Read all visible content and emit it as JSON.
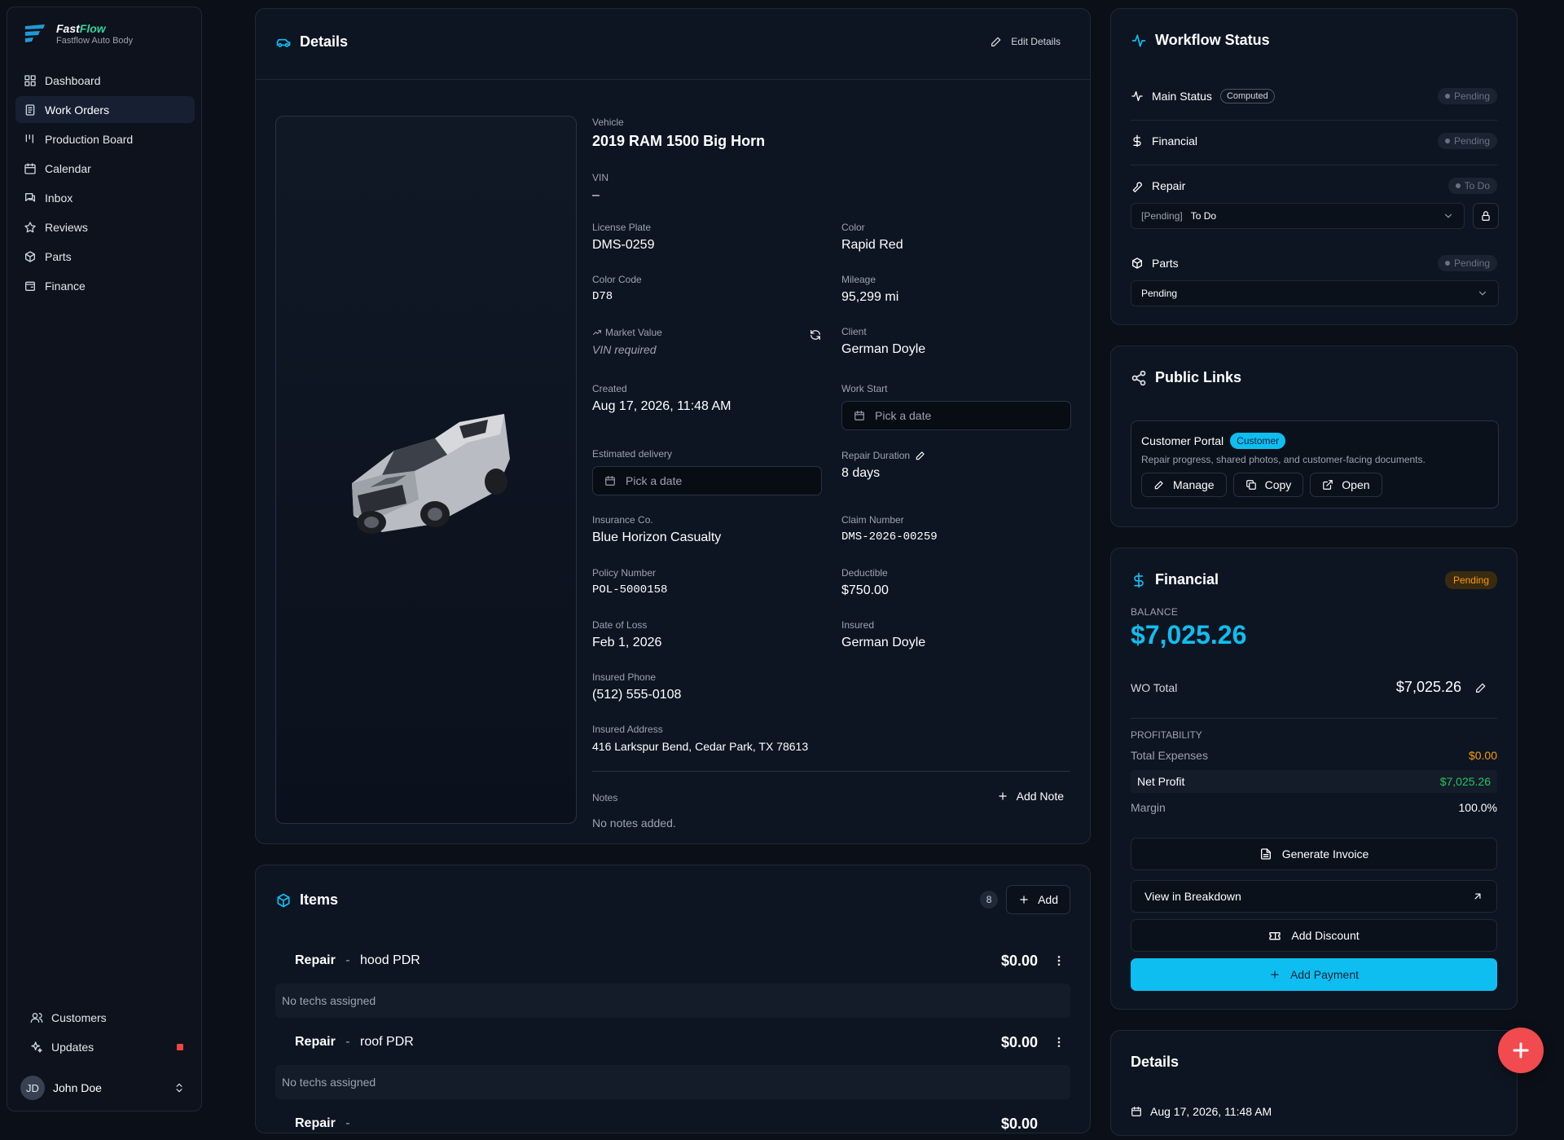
{
  "brand": {
    "name_a": "Fast",
    "name_b": "Flow",
    "subtitle": "Fastflow Auto Body"
  },
  "nav": {
    "items": [
      {
        "label": "Dashboard",
        "icon": "dashboard-icon"
      },
      {
        "label": "Work Orders",
        "icon": "clipboard-icon",
        "active": true
      },
      {
        "label": "Production Board",
        "icon": "board-icon"
      },
      {
        "label": "Calendar",
        "icon": "calendar-icon"
      },
      {
        "label": "Inbox",
        "icon": "inbox-icon"
      },
      {
        "label": "Reviews",
        "icon": "star-icon"
      },
      {
        "label": "Parts",
        "icon": "box-icon"
      },
      {
        "label": "Finance",
        "icon": "finance-icon"
      }
    ],
    "bottom": [
      {
        "label": "Customers",
        "icon": "users-icon"
      },
      {
        "label": "Updates",
        "icon": "sparkle-icon"
      }
    ]
  },
  "user": {
    "initials": "JD",
    "name": "John Doe"
  },
  "details": {
    "title": "Details",
    "edit_label": "Edit Details",
    "vehicle_label": "Vehicle",
    "vehicle": "2019 RAM 1500 Big Horn",
    "vin_label": "VIN",
    "vin": "–",
    "plate_label": "License Plate",
    "plate": "DMS-0259",
    "color_label": "Color",
    "color": "Rapid Red",
    "color_code_label": "Color Code",
    "color_code": "D78",
    "mileage_label": "Mileage",
    "mileage": "95,299 mi",
    "market_label": "Market Value",
    "market": "VIN required",
    "client_label": "Client",
    "client": "German Doyle",
    "created_label": "Created",
    "created": "Aug 17, 2026, 11:48 AM",
    "work_start_label": "Work Start",
    "work_start_placeholder": "Pick a date",
    "est_label": "Estimated delivery",
    "est_placeholder": "Pick a date",
    "duration_label": "Repair Duration",
    "duration": "8 days",
    "ins_label": "Insurance Co.",
    "ins": "Blue Horizon Casualty",
    "claim_label": "Claim Number",
    "claim": "DMS-2026-00259",
    "policy_label": "Policy Number",
    "policy": "POL-5000158",
    "deductible_label": "Deductible",
    "deductible": "$750.00",
    "dol_label": "Date of Loss",
    "dol": "Feb 1, 2026",
    "insured_label": "Insured",
    "insured": "German Doyle",
    "phone_label": "Insured Phone",
    "phone": "(512) 555-0108",
    "address_label": "Insured Address",
    "address": "416 Larkspur Bend, Cedar Park, TX 78613",
    "notes_label": "Notes",
    "add_note": "Add Note",
    "notes_empty": "No notes added."
  },
  "items": {
    "title": "Items",
    "count": "8",
    "add_label": "Add",
    "rows": [
      {
        "type": "Repair",
        "sep": "-",
        "name": "hood PDR",
        "price": "$0.00",
        "techs": "No techs assigned"
      },
      {
        "type": "Repair",
        "sep": "-",
        "name": "roof PDR",
        "price": "$0.00",
        "techs": "No techs assigned"
      },
      {
        "type": "Repair",
        "sep": "-",
        "name": "",
        "price": "$0.00",
        "techs": ""
      }
    ]
  },
  "workflow": {
    "title": "Workflow Status",
    "main_label": "Main Status",
    "computed": "Computed",
    "main_status": "Pending",
    "financial_label": "Financial",
    "financial_status": "Pending",
    "repair_label": "Repair",
    "repair_status": "To Do",
    "repair_select_prefix": "[Pending]",
    "repair_select": "To Do",
    "parts_label": "Parts",
    "parts_status": "Pending",
    "parts_select": "Pending"
  },
  "links": {
    "title": "Public Links",
    "portal_title": "Customer Portal",
    "portal_badge": "Customer",
    "portal_desc": "Repair progress, shared photos, and customer-facing documents.",
    "manage": "Manage",
    "copy": "Copy",
    "open": "Open"
  },
  "financial": {
    "title": "Financial",
    "status": "Pending",
    "balance_label": "BALANCE",
    "balance": "$7,025.26",
    "wo_label": "WO Total",
    "wo_total": "$7,025.26",
    "profit_label": "PROFITABILITY",
    "exp_label": "Total Expenses",
    "expenses": "$0.00",
    "net_label": "Net Profit",
    "net": "$7,025.26",
    "margin_label": "Margin",
    "margin": "100.0%",
    "invoice": "Generate Invoice",
    "breakdown": "View in Breakdown",
    "discount": "Add Discount",
    "payment": "Add Payment"
  },
  "details2": {
    "title": "Details",
    "created": "Aug 17, 2026, 11:48 AM"
  },
  "colors": {
    "accent": "#0ebef0",
    "pending": "#f59e0b",
    "profit": "#22c55e",
    "fab": "#f14a4f"
  }
}
